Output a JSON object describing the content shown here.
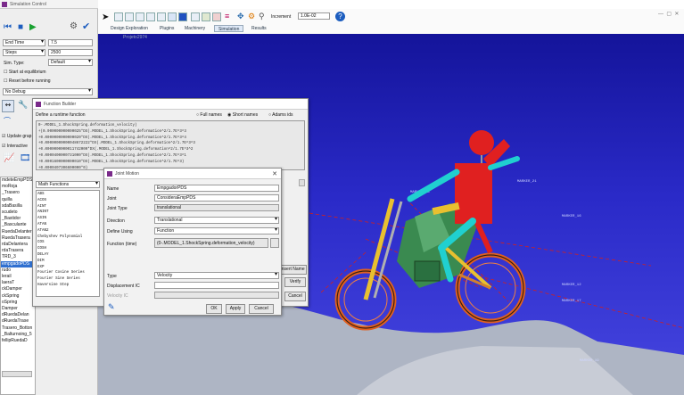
{
  "sim_controls": {
    "window_title": "Simulation Control",
    "end_time_label": "End Time",
    "end_time_value": "7.5",
    "steps_label": "Steps",
    "steps_value": "2500",
    "sim_type_label": "Sim. Type:",
    "sim_type_value": "Default",
    "start_equilibrium": "Start at equilibrium",
    "reset_before": "Reset before running",
    "debug_value": "No Debug",
    "update_label": "Update grap",
    "interactive_label": "Interactive"
  },
  "ribbon": {
    "tabs": [
      "Design Exploration",
      "Plugins",
      "Machinery",
      "Simulation",
      "Results"
    ],
    "active_tab": "Simulation",
    "increment_label": "Increment",
    "increment_value": "1.0E-02"
  },
  "viewport_caption": "Projeto2974",
  "tree": {
    "items": [
      "mdeteEmpPDS",
      "moRoja",
      "_Trasero",
      "quilla",
      "sdaBasilla",
      "scudeto",
      "_Bastidor",
      "_Basculante",
      "RuedaDelanter",
      "RuedaTrasera",
      "rdaDelantera",
      "rdaTrasera",
      "",
      "TRD_3",
      "empgadoPDS",
      "",
      "rudo",
      "lerail",
      "laeraT",
      "ckDamper",
      "ckSpring",
      "oSpring",
      "Damper",
      "dRuedaDelan",
      "dRuedaTrase",
      "Trasero_Botton",
      "_Balturnoing_5",
      "fellipRuedaD"
    ]
  },
  "function_builder": {
    "window_title": "Function Builder",
    "define_label": "Define a runtime function",
    "options": [
      "Full names",
      "Short names",
      "Adams ids"
    ],
    "selected_option": "Short names",
    "expression_lines": [
      "0-.MODEL_1.ShockSpring.deformation_velocity)",
      "+(0.000000000000025*DX(.MODEL_1.ShockSpring.deformation^2/1.7E^3^3",
      "+0.0000000000000020*DX(.MODEL_1.ShockSpring.deformation^2/1.7E^3^4",
      "+0.00000000000048672222*DX(.MODEL_1.ShockSpring.deformation^2/1.7E^3^3",
      "+0.0000000000011742000*DX(.MODEL_1.ShockSpring.deformation^2/1.7E^3^2",
      "+0.0000400000731000*DX(.MODEL_1.ShockSpring.deformation^2/1.7E^3^1",
      "+0.0001600000000010*DX(.MODEL_1.ShockSpring.deformation^2/1.7E^3)",
      "+0.0000407306600000*0)"
    ],
    "category_value": "Math Functions",
    "functions": [
      "ABS",
      "ACOS",
      "AINT",
      "ANINT",
      "ASIN",
      "ATAN",
      "ATAN2",
      "Chebyshev Polynomial",
      "COS",
      "COSH",
      "DELAY",
      "DIM",
      "EXP",
      "Fourier Cosine Series",
      "Fourier Sine Series",
      "Haversine Step"
    ],
    "insert_label": "Insert Name",
    "verify_label": "Verify",
    "cancel_label": "Cancel"
  },
  "joint_motion": {
    "window_title": "Joint Motion",
    "name_label": "Name",
    "name_value": "EmpgadorPDS",
    "joint_label": "Joint",
    "joint_value": "ConsideraEmpPDS",
    "joint_type_label": "Joint Type",
    "joint_type_value": "translational",
    "direction_label": "Direction",
    "direction_value": "Translational",
    "define_using_label": "Define Using",
    "define_using_value": "Function",
    "function_label": "Function (time)",
    "function_value": "(0-.MODEL_1.ShockSpring.deformation_velocity)",
    "type_label": "Type",
    "type_value": "Velocity",
    "disp_ic_label": "Displacement IC",
    "vel_ic_label": "Velocity IC",
    "ok_label": "OK",
    "apply_label": "Apply",
    "cancel_label": "Cancel"
  },
  "markers": [
    "MARKER_21",
    "MARKER_15",
    "MARKER_16",
    "MARKER_3",
    "MARKER_12",
    "MARKER_17",
    "MARKER_19"
  ],
  "colors": {
    "sky_top": "#1a1aa0",
    "sky_bottom": "#4040d8",
    "ground": "#a8b0c0",
    "accent": "#7a2a8a"
  }
}
